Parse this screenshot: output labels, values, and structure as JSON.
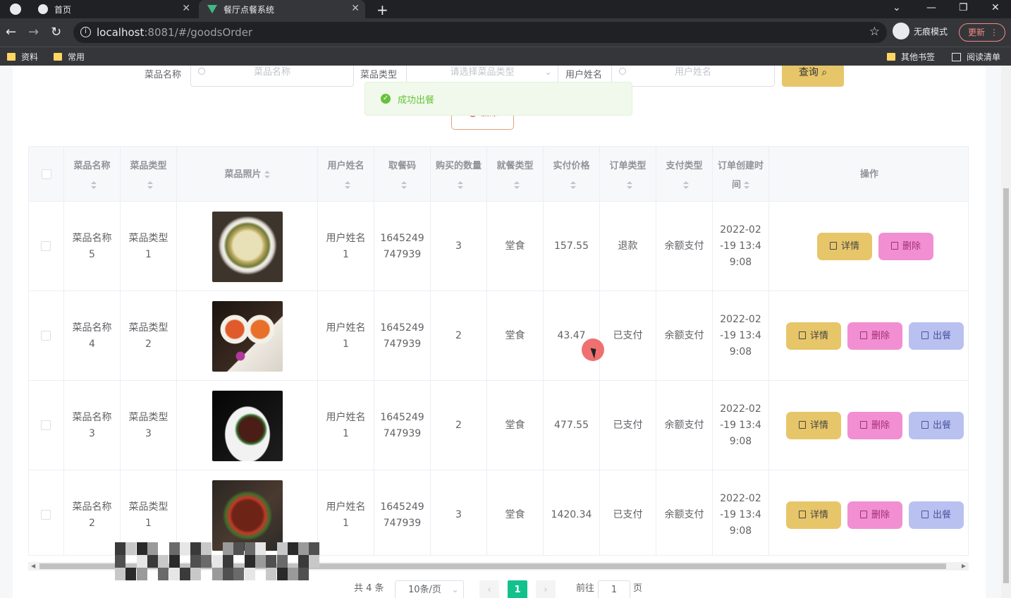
{
  "browser": {
    "tabs": [
      {
        "title": "首页"
      },
      {
        "title": "餐厅点餐系统"
      }
    ],
    "url_host": "localhost",
    "url_rest": ":8081/#/goodsOrder",
    "incognito_label": "无痕模式",
    "update_label": "更新",
    "bookmarks": [
      "资料",
      "常用"
    ],
    "bookmarks_right": [
      "其他书签",
      "阅读清单"
    ]
  },
  "search": {
    "dish_name_label": "菜品名称",
    "dish_name_placeholder": "菜品名称",
    "dish_type_label": "菜品类型",
    "dish_type_placeholder": "请选择菜品类型",
    "user_name_label": "用户姓名",
    "user_name_placeholder": "用户姓名",
    "query_button": "查询",
    "delete_button": "删除"
  },
  "toast": {
    "message": "成功出餐",
    "color": "#67c23a"
  },
  "table": {
    "headers": [
      "菜品名称",
      "菜品类型",
      "菜品照片",
      "用户姓名",
      "取餐码",
      "购买的数量",
      "就餐类型",
      "实付价格",
      "订单类型",
      "支付类型",
      "订单创建时间",
      "操作"
    ],
    "rows": [
      {
        "dish_name": "菜品名称5",
        "dish_type": "菜品类型1",
        "user_name": "用户姓名1",
        "pickup_code": "1645249747939",
        "quantity": "3",
        "dining_type": "堂食",
        "price": "157.55",
        "order_type": "退款",
        "pay_type": "余额支付",
        "created": "2022-02-19 13:49:08",
        "photo_theme": "soup"
      },
      {
        "dish_name": "菜品名称4",
        "dish_type": "菜品类型2",
        "user_name": "用户姓名1",
        "pickup_code": "1645249747939",
        "quantity": "2",
        "dining_type": "堂食",
        "price": "43.47",
        "order_type": "已支付",
        "pay_type": "余额支付",
        "created": "2022-02-19 13:49:08",
        "photo_theme": "bowls"
      },
      {
        "dish_name": "菜品名称3",
        "dish_type": "菜品类型3",
        "user_name": "用户姓名1",
        "pickup_code": "1645249747939",
        "quantity": "2",
        "dining_type": "堂食",
        "price": "477.55",
        "order_type": "已支付",
        "pay_type": "余额支付",
        "created": "2022-02-19 13:49:08",
        "photo_theme": "plated"
      },
      {
        "dish_name": "菜品名称2",
        "dish_type": "菜品类型1",
        "user_name": "用户姓名1",
        "pickup_code": "1645249747939",
        "quantity": "3",
        "dining_type": "堂食",
        "price": "1420.34",
        "order_type": "已支付",
        "pay_type": "余额支付",
        "created": "2022-02-19 13:49:08",
        "photo_theme": "meat"
      }
    ],
    "actions": {
      "detail": "详情",
      "delete": "删除",
      "serve": "出餐"
    }
  },
  "pagination": {
    "total_text": "共 4 条",
    "page_size": "10条/页",
    "current_page": "1",
    "goto_label": "前往",
    "goto_value": "1",
    "page_suffix": "页"
  },
  "colors": {
    "detail_btn": "#e7c66a",
    "delete_btn": "#f18fd2",
    "serve_btn": "#b9c1f0",
    "page_active": "#13c18d"
  }
}
